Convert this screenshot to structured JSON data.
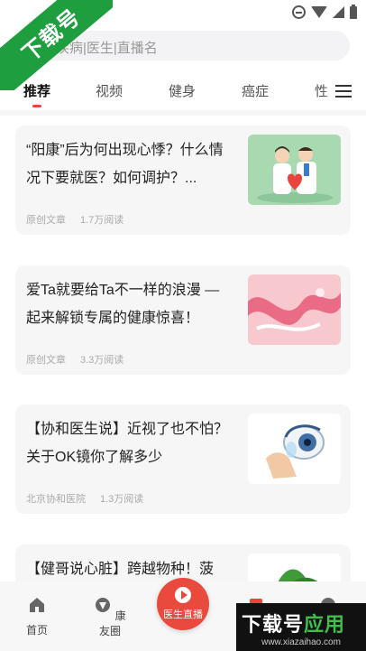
{
  "watermark": {
    "corner_text": "下载号",
    "bottom_text_white": "下载号",
    "bottom_text_green": "应用",
    "bottom_url": "www.xiazaihao.com"
  },
  "search": {
    "placeholder": "疾病|医生|直播名"
  },
  "tabs": [
    {
      "label": "推荐",
      "active": true
    },
    {
      "label": "视频"
    },
    {
      "label": "健身"
    },
    {
      "label": "癌症"
    },
    {
      "label": "性"
    }
  ],
  "articles": [
    {
      "title": "“阳康”后为何出现心悸？什么情况下要就医？如何调护？...",
      "source": "原创文章",
      "reads": "1.7万阅读",
      "thumb": "doctors"
    },
    {
      "title": "爱Ta就要给Ta不一样的浪漫 —起来解锁专属的健康惊喜！",
      "source": "原创文章",
      "reads": "3.3万阅读",
      "thumb": "ribbon"
    },
    {
      "title": "【协和医生说】近视了也不怕？关于OK镜你了解多少",
      "source": "北京协和医院",
      "reads": "1.3万阅读",
      "thumb": "eye-lens"
    },
    {
      "title": "【健哥说心脏】跨越物种！菠",
      "source": "",
      "reads": "",
      "thumb": "spinach"
    }
  ],
  "bottom_nav": {
    "home": "首页",
    "community": "康友圈",
    "live": "医生直播"
  },
  "colors": {
    "accent": "#ea4a3d",
    "watermark_green": "#1e9e3f"
  }
}
